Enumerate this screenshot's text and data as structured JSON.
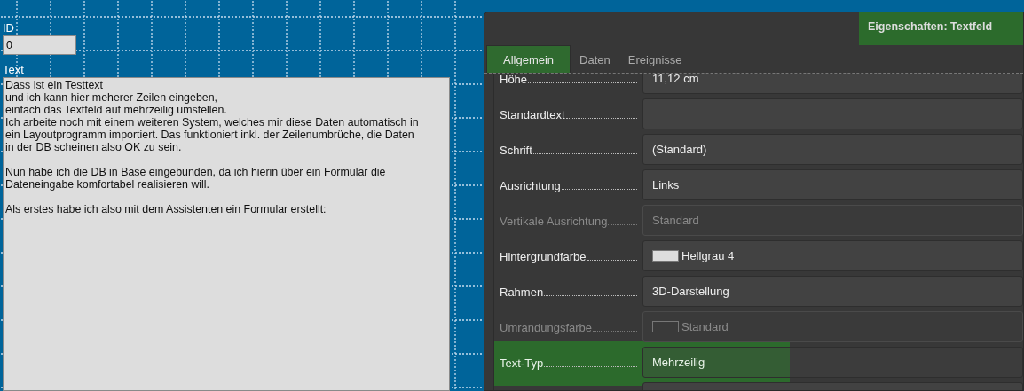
{
  "form": {
    "fields": [
      {
        "kind": "line",
        "label": "ID",
        "value": "0"
      },
      {
        "kind": "multiline",
        "label": "Text",
        "value": "Dass ist ein Testtext\nund ich kann hier meherer Zeilen eingeben,\neinfach das Textfeld auf mehrzeilig umstellen.\nIch arbeite noch mit einem weiteren System, welches mir diese Daten automatisch in\nein Layoutprogramm importiert. Das funktioniert inkl. der Zeilenumbrüche, die Daten\nin der DB scheinen also OK zu sein.\n\nNun habe ich die DB in Base eingebunden, da ich hierin über ein Formular die\nDateneingabe komfortabel realisieren will.\n\nAls erstes habe ich also mit dem Assistenten ein Formular erstellt:"
      }
    ]
  },
  "dialog": {
    "title": "Eigenschaften: Textfeld",
    "title_highlighted": true,
    "tabs": [
      {
        "label": "Allgemein",
        "selected": true,
        "highlighted": true
      },
      {
        "label": "Daten",
        "selected": false,
        "highlighted": false
      },
      {
        "label": "Ereignisse",
        "selected": false,
        "highlighted": false
      }
    ],
    "properties": [
      {
        "label": "Höhe",
        "value": "11,12 cm",
        "disabled": false,
        "highlighted": false
      },
      {
        "label": "Standardtext",
        "disabled": false,
        "highlighted": false
      },
      {
        "label": "Schrift",
        "value": "(Standard)",
        "disabled": false,
        "highlighted": false
      },
      {
        "label": "Ausrichtung",
        "value": "Links",
        "disabled": false,
        "highlighted": false
      },
      {
        "label": "Vertikale Ausrichtung",
        "value": "Standard",
        "disabled": true,
        "highlighted": false
      },
      {
        "label": "Hintergrundfarbe",
        "value": "Hellgrau 4",
        "color": "#dddddd",
        "disabled": false,
        "highlighted": false
      },
      {
        "label": "Rahmen",
        "value": "3D-Darstellung",
        "disabled": false,
        "highlighted": false
      },
      {
        "label": "Umrandungsfarbe",
        "value": "Standard",
        "color": "#3a3a3a",
        "disabled": true,
        "highlighted": false
      },
      {
        "label": "Text-Typ",
        "value": "Mehrzeilig",
        "disabled": false,
        "highlighted": true
      },
      {
        "disabled": false,
        "highlighted": false
      }
    ]
  }
}
